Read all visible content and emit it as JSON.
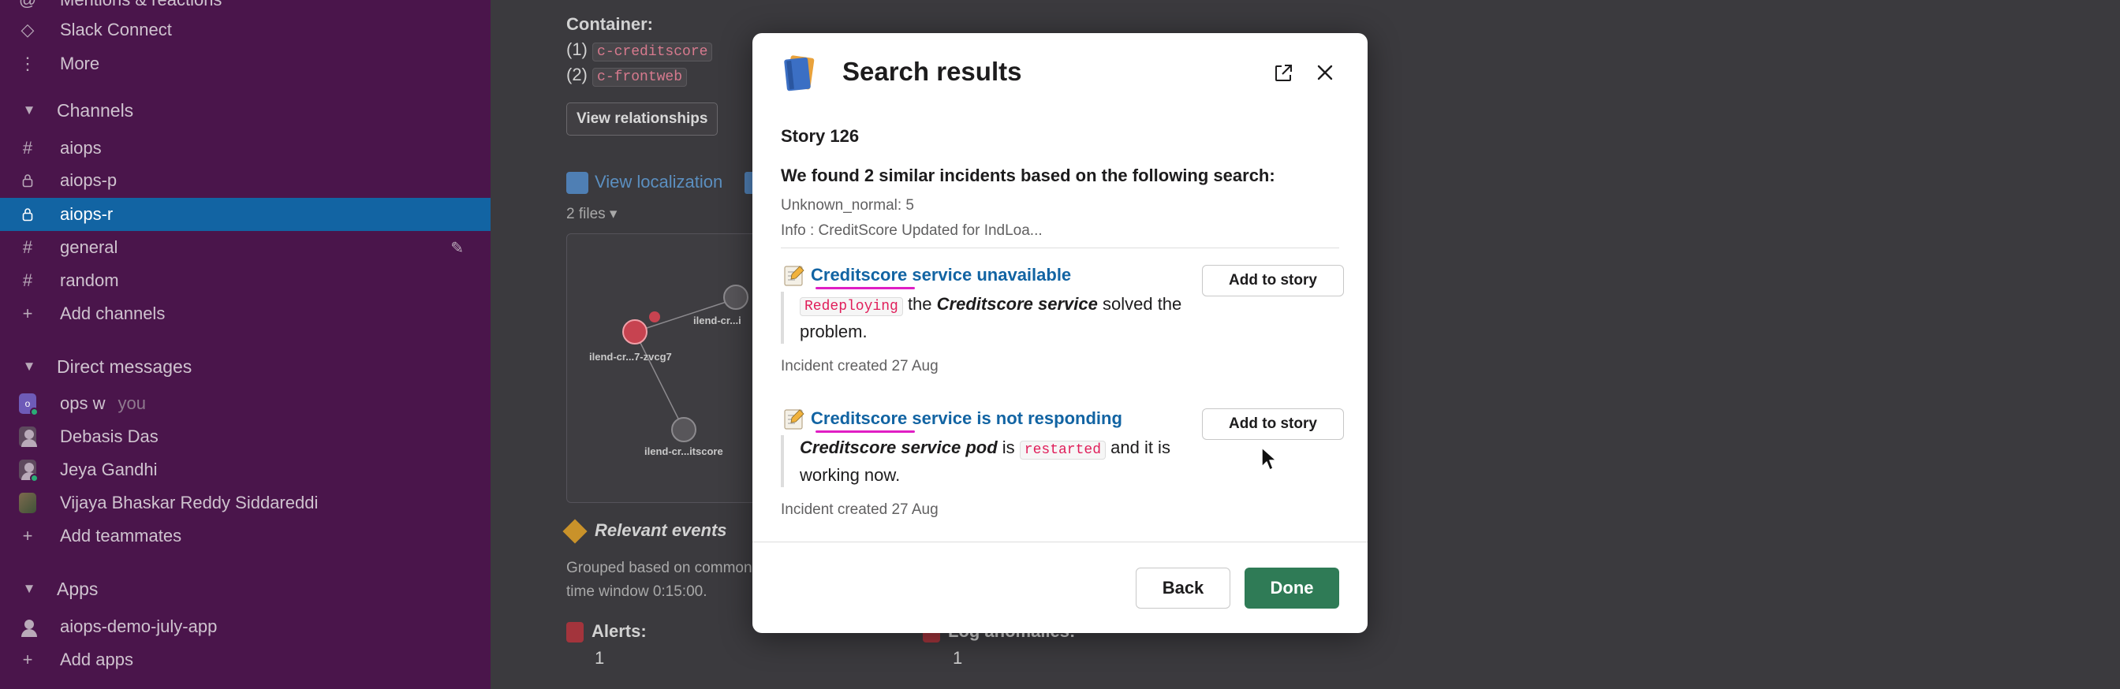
{
  "sidebar": {
    "top_items": [
      {
        "label": "Mentions & reactions",
        "icon": "at-icon"
      },
      {
        "label": "Slack Connect",
        "icon": "connect-icon"
      },
      {
        "label": "More",
        "icon": "more-vertical-icon"
      }
    ],
    "channels_header": "Channels",
    "channels": [
      {
        "label": "aiops",
        "icon": "hash-icon"
      },
      {
        "label": "aiops-p",
        "icon": "lock-icon"
      },
      {
        "label": "aiops-r",
        "icon": "lock-icon",
        "active": true
      },
      {
        "label": "general",
        "icon": "hash-icon"
      },
      {
        "label": "random",
        "icon": "hash-icon"
      }
    ],
    "add_channels": "Add channels",
    "dm_header": "Direct messages",
    "dms": [
      {
        "label": "ops w",
        "sub": "you"
      },
      {
        "label": "Debasis Das"
      },
      {
        "label": "Jeya Gandhi"
      },
      {
        "label": "Vijaya Bhaskar Reddy Siddareddi"
      }
    ],
    "add_teammates": "Add teammates",
    "apps_header": "Apps",
    "apps": [
      {
        "label": "aiops-demo-july-app"
      }
    ],
    "add_apps": "Add apps"
  },
  "background": {
    "container_label": "Container:",
    "containers": [
      {
        "index": "(1)",
        "name": "c-creditscore"
      },
      {
        "index": "(2)",
        "name": "c-frontweb"
      }
    ],
    "view_relationships": "View relationships",
    "view_localization": "View localization",
    "files": "2 files",
    "graph_nodes": [
      "ilend-cr...7-zvcg7",
      "ilend-cr...i",
      "ilend-cr...itscore"
    ],
    "relevant_events": "Relevant events",
    "grouped_text": "Grouped based on common",
    "time_window": "time window 0:15:00.",
    "alerts_label": "Alerts:",
    "alerts_count": "1",
    "log_anomalies_label": "Log anomalies:",
    "log_anomalies_count": "1"
  },
  "modal": {
    "title": "Search results",
    "story": "Story 126",
    "found_text": "We found 2 similar incidents based on the following search:",
    "search_meta_1": "Unknown_normal: 5",
    "search_meta_2": "Info : CreditScore Updated for IndLoa...",
    "incidents": [
      {
        "title": "Creditscore service unavailable",
        "code": "Redeploying",
        "text_mid": " the ",
        "em": "Creditscore service",
        "text_end": " solved the problem.",
        "created": "Incident created 27 Aug",
        "button": "Add to story"
      },
      {
        "title": "Creditscore service is not responding",
        "em": "Creditscore service pod",
        "text_mid": " is ",
        "code": "restarted",
        "text_end": " and it is working now.",
        "created": "Incident created 27 Aug",
        "button": "Add to story"
      }
    ],
    "back": "Back",
    "done": "Done"
  },
  "colors": {
    "sidebar_bg": "#4a154b",
    "active_channel": "#1264a3",
    "link": "#1264a3",
    "done_button": "#2f7b56",
    "highlight_underline": "#e01ec4"
  }
}
